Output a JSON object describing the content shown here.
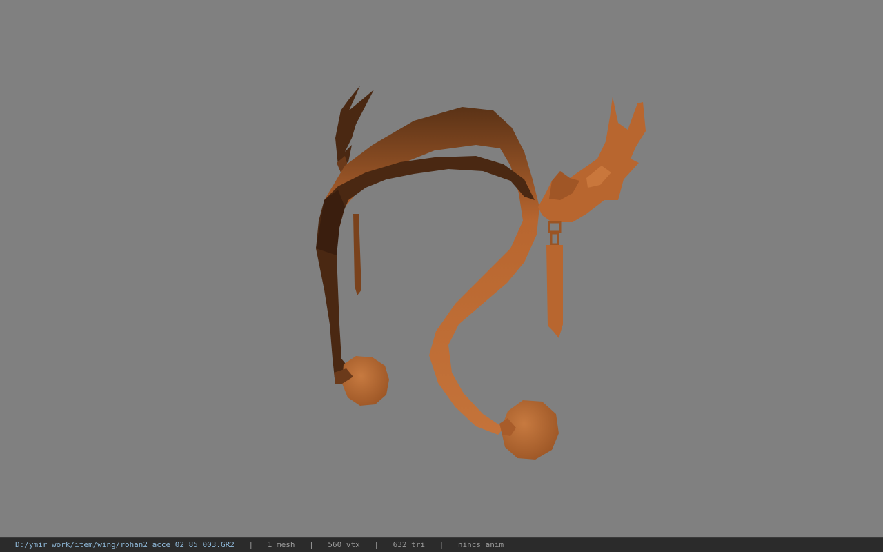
{
  "viewport": {
    "background": "#808080",
    "model_colors": {
      "dark_brown": "#4a2812",
      "mid_brown": "#6b3a1a",
      "orange": "#b8642e",
      "light_orange": "#c9773c"
    }
  },
  "statusbar": {
    "file_path": "D:/ymir work/item/wing/rohan2_acce_02_85_003.GR2",
    "separator": "|",
    "mesh_count": "1 mesh",
    "vertex_count": "560 vtx",
    "triangle_count": "632 tri",
    "anim_status": "nincs anim"
  }
}
